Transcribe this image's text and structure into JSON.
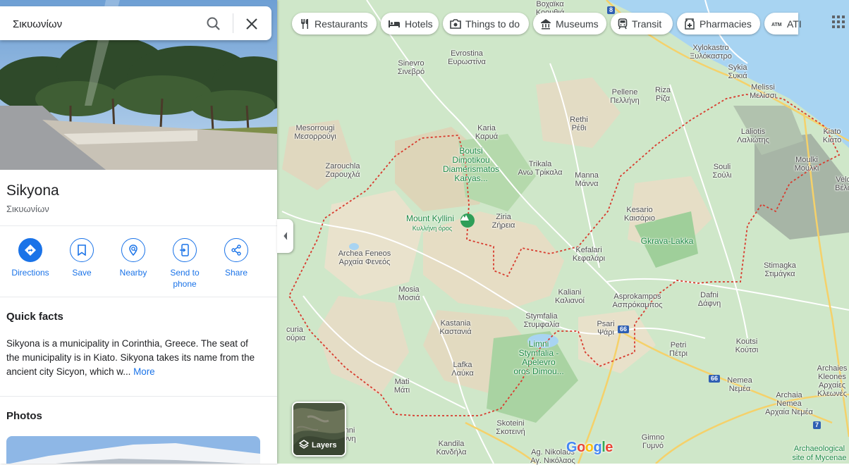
{
  "search": {
    "value": "Σικυωνίων"
  },
  "place": {
    "title": "Sikyona",
    "subtitle": "Σικυωνίων"
  },
  "actions": [
    {
      "label": "Directions"
    },
    {
      "label": "Save"
    },
    {
      "label": "Nearby"
    },
    {
      "label": "Send to\nphone"
    },
    {
      "label": "Share"
    }
  ],
  "quick_facts": {
    "heading": "Quick facts",
    "text": "Sikyona is a municipality in Corinthia, Greece. The seat of the municipality is in Kiato. Sikyona takes its name from the ancient city Sicyon, which w...",
    "more": "More"
  },
  "photos": {
    "heading": "Photos"
  },
  "chips": [
    {
      "label": "Restaurants",
      "icon": "fork-knife-icon"
    },
    {
      "label": "Hotels",
      "icon": "bed-icon"
    },
    {
      "label": "Things to do",
      "icon": "camera-icon"
    },
    {
      "label": "Museums",
      "icon": "museum-icon"
    },
    {
      "label": "Transit",
      "icon": "train-icon"
    },
    {
      "label": "Pharmacies",
      "icon": "pharmacy-icon"
    },
    {
      "label": "ATI",
      "icon": "atm-icon"
    }
  ],
  "layers": {
    "label": "Layers"
  },
  "map_labels": {
    "sinevro": "Sinevro\nΣινεβρό",
    "evrostina": "Evrostina\nΕυρωστίνα",
    "xylokastro": "Xylokastro\nΞυλόκαστρο",
    "sykia": "Sykia\nΣυκιά",
    "melissi": "Melissi\nΜελίσσι",
    "pellene": "Pellene\nΠελλήνη",
    "riza": "Riza\nΡίζα",
    "mesorrougi": "Mesorrougi\nΜεσορρούγι",
    "karia": "Karia\nΚαρυά",
    "rethi": "Rethi\nΡέθι",
    "laliotis": "Laliotis\nΛαλιώτης",
    "kiato": "Kiato\nΚιάτο",
    "boutsi": "Boutsi\nDimotikou\nDiamerismatos\nKaryas...",
    "zarouchla": "Zarouchla\nΖαρουχλά",
    "trikala": "Trikala\nΑνω Τρίκαλα",
    "manna": "Manna\nΜάννα",
    "souli": "Souli\nΣούλι",
    "moulki": "Moulki\nΜούλκι",
    "velo": "Velo\nΒέλο",
    "mount_kyllini": "Mount Kyllini",
    "mount_kyllini_gr": "Κυλλήνη όρος",
    "ziria": "Ziria\nΖήρεια",
    "kesario": "Kesario\nΚαισάριο",
    "gkrava": "Gkrava-Lakka",
    "archea_feneos": "Archea Feneos\nΑρχαία Φενεός",
    "kefalari": "Kefalari\nΚεφαλάρι",
    "stimagka": "Stimagka\nΣτιμάγκα",
    "mosia": "Mosia\nΜοσιά",
    "kaliani": "Kaliani\nΚαλιανοί",
    "asprokampos": "Asprokampos\nΑσπρόκαμπος",
    "dafni": "Dafni\nΔάφνη",
    "kastania": "Kastania\nΚαστανιά",
    "stymfalia": "Stymfalia\nΣτυμφαλία",
    "psari": "Psari\nΨάρι",
    "kaliani_left": "curia\nούρια",
    "limni": "Limni\nStymfalia -\nApelevro\noros Dimou...",
    "petri": "Petri\nΠέτρι",
    "koutsi": "Koutsi\nΚούτσι",
    "lafka": "Lafka\nΛαύκα",
    "mati": "Mati\nΜάτι",
    "nemea": "Nemea\nΝεμέα",
    "archaia_nemea": "Archaia\nNemea\nΑρχαία Νεμέα",
    "archaies_kleones": "Archaies\nKleones\nΑρχαίες\nΚλεωνές",
    "skoteini": "Skoteini\nΣκοτεινή",
    "kandila": "Kandila\nΚανδήλα",
    "gimno": "Gimno\nΓυμνό",
    "ag_nikolaos": "Ag. Nikolaos\nΑγ. Νικόλαος",
    "archaeological": "Archaeological\nsite of Mycenae",
    "nni": "nni\nννη",
    "vochaika": "Βοχαϊκα\nΚοουθιά"
  },
  "route_shields": [
    "8",
    "66",
    "66",
    "7"
  ],
  "google_logo": "Google"
}
